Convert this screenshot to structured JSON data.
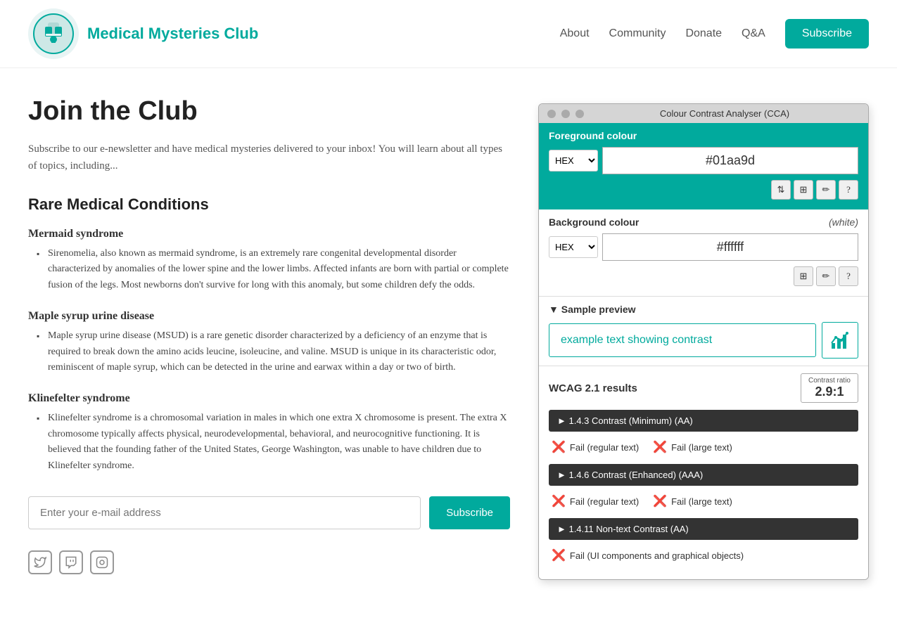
{
  "header": {
    "logo_alt": "Medical Mysteries Club logo",
    "site_title": "Medical Mysteries Club",
    "nav": {
      "about": "About",
      "community": "Community",
      "donate": "Donate",
      "qa": "Q&A",
      "subscribe": "Subscribe"
    }
  },
  "main": {
    "page_title": "Join the Club",
    "intro": "Subscribe to our e-newsletter and have medical mysteries delivered to your inbox! You will learn about all types of topics, including...",
    "section_title": "Rare Medical Conditions",
    "conditions": [
      {
        "title": "Mermaid syndrome",
        "description": "Sirenomelia, also known as mermaid syndrome, is an extremely rare congenital developmental disorder characterized by anomalies of the lower spine and the lower limbs. Affected infants are born with partial or complete fusion of the legs. Most newborns don't survive for long with this anomaly, but some children defy the odds."
      },
      {
        "title": "Maple syrup urine disease",
        "description": "Maple syrup urine disease (MSUD) is a rare genetic disorder characterized by a deficiency of an enzyme that is required to break down the amino acids leucine, isoleucine, and valine. MSUD is unique in its characteristic odor, reminiscent of maple syrup, which can be detected in the urine and earwax within a day or two of birth."
      },
      {
        "title": "Klinefelter syndrome",
        "description": "Klinefelter syndrome is a chromosomal variation in males in which one extra X chromosome is present. The extra X chromosome typically affects physical, neurodevelopmental, behavioral, and neurocognitive functioning. It is believed that the founding father of the United States, George Washington, was unable to have children due to Klinefelter syndrome."
      }
    ],
    "email_placeholder": "Enter your e-mail address",
    "subscribe_btn": "Subscribe"
  },
  "cca": {
    "title": "Colour Contrast Analyser (CCA)",
    "fg_label": "Foreground colour",
    "fg_format": "HEX",
    "fg_value": "#01aa9d",
    "bg_label": "Background colour",
    "bg_white": "(white)",
    "bg_format": "HEX",
    "bg_value": "#ffffff",
    "sample_label": "▼ Sample preview",
    "sample_text": "example text showing contrast",
    "wcag_label": "WCAG 2.1 results",
    "contrast_ratio_label": "Contrast ratio",
    "contrast_ratio_value": "2.9:1",
    "criteria": [
      {
        "id": "1_4_3",
        "label": "► 1.4.3 Contrast (Minimum) (AA)",
        "results": [
          {
            "label": "Fail (regular text)"
          },
          {
            "label": "Fail (large text)"
          }
        ]
      },
      {
        "id": "1_4_6",
        "label": "► 1.4.6 Contrast (Enhanced) (AAA)",
        "results": [
          {
            "label": "Fail (regular text)"
          },
          {
            "label": "Fail (large text)"
          }
        ]
      },
      {
        "id": "1_4_11",
        "label": "► 1.4.11 Non-text Contrast (AA)",
        "results": [
          {
            "label": "Fail (UI components and graphical objects)"
          }
        ]
      }
    ]
  },
  "social": {
    "twitter": "🐦",
    "twitch": "📺",
    "instagram": "📷"
  }
}
